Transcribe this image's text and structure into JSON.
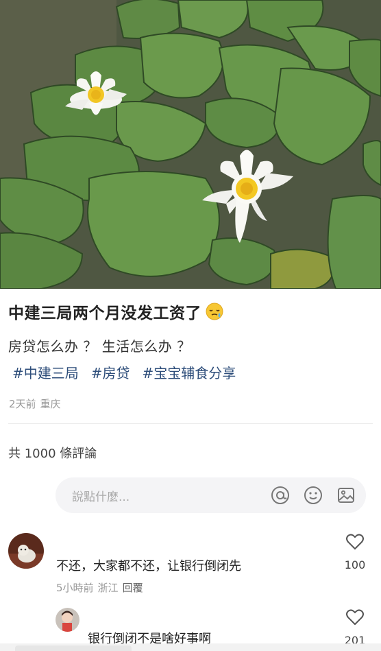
{
  "post": {
    "title": "中建三局两个月没发工资了",
    "title_emoji": "sleepy-face-emoji",
    "body": "房贷怎么办 ？ 生活怎么办 ？",
    "tags": [
      "#中建三局",
      "#房贷",
      "#宝宝辅食分享"
    ],
    "time": "2天前",
    "location": "重庆",
    "image_subject": "water-lily-pond-photo"
  },
  "comments_section": {
    "count_label": "共 1000 條評論",
    "input_placeholder": "說點什麼...",
    "input_icons": [
      "at-icon",
      "emoji-icon",
      "image-icon"
    ]
  },
  "comments": [
    {
      "text": "不还，大家都不还，让银行倒闭先",
      "time": "5小時前",
      "location": "浙江",
      "reply_label": "回覆",
      "likes": "100"
    },
    {
      "text": "银行倒闭不是啥好事啊",
      "likes": "201"
    }
  ],
  "colors": {
    "tag": "#2d4d7a",
    "muted": "#999999",
    "input_bg": "#f4f4f6"
  }
}
